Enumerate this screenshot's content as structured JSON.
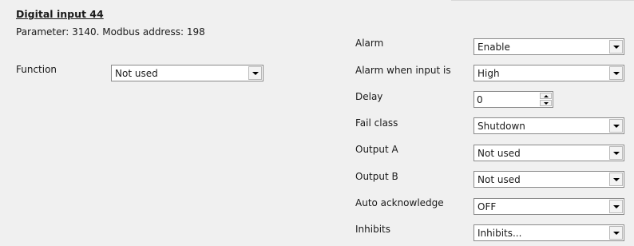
{
  "header": {
    "title": "Digital input 44",
    "parameter_line": "Parameter: 3140. Modbus address: 198"
  },
  "function": {
    "label": "Function",
    "value": "Not used"
  },
  "settings": {
    "alarm": {
      "label": "Alarm",
      "value": "Enable"
    },
    "alarm_when_input_is": {
      "label": "Alarm when input is",
      "value": "High"
    },
    "delay": {
      "label": "Delay",
      "value": "0"
    },
    "fail_class": {
      "label": "Fail class",
      "value": "Shutdown"
    },
    "output_a": {
      "label": "Output A",
      "value": "Not used"
    },
    "output_b": {
      "label": "Output B",
      "value": "Not used"
    },
    "auto_acknowledge": {
      "label": "Auto acknowledge",
      "value": "OFF"
    },
    "inhibits": {
      "label": "Inhibits",
      "value": "Inhibits..."
    }
  },
  "icons": {
    "dropdown": "chevron-down-icon",
    "spin_up": "spin-up-icon",
    "spin_down": "spin-down-icon"
  },
  "colors": {
    "background": "#f0f0f0",
    "field_background": "#ffffff",
    "field_border": "#8a8a8a"
  }
}
